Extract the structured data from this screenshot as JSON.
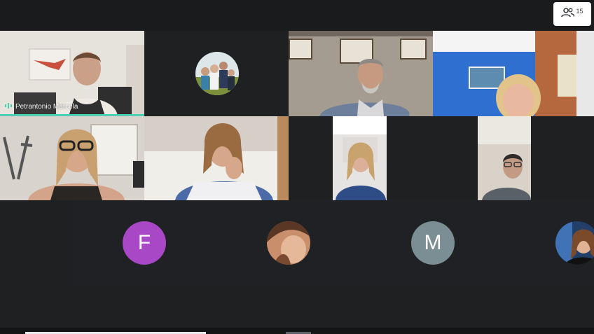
{
  "participants_button": {
    "count": "15",
    "icon": "people-icon"
  },
  "speaker": {
    "name": "Petrantonio Marcela",
    "icon": "audio-level-icon"
  },
  "avatars": [
    {
      "initial": "F",
      "color": "#a848c6"
    },
    {
      "initial": "M",
      "color": "#7a8e94"
    }
  ],
  "colors": {
    "background": "#1f2021",
    "tile": "#3c4043",
    "speaking_indicator": "#4ecfb3"
  }
}
